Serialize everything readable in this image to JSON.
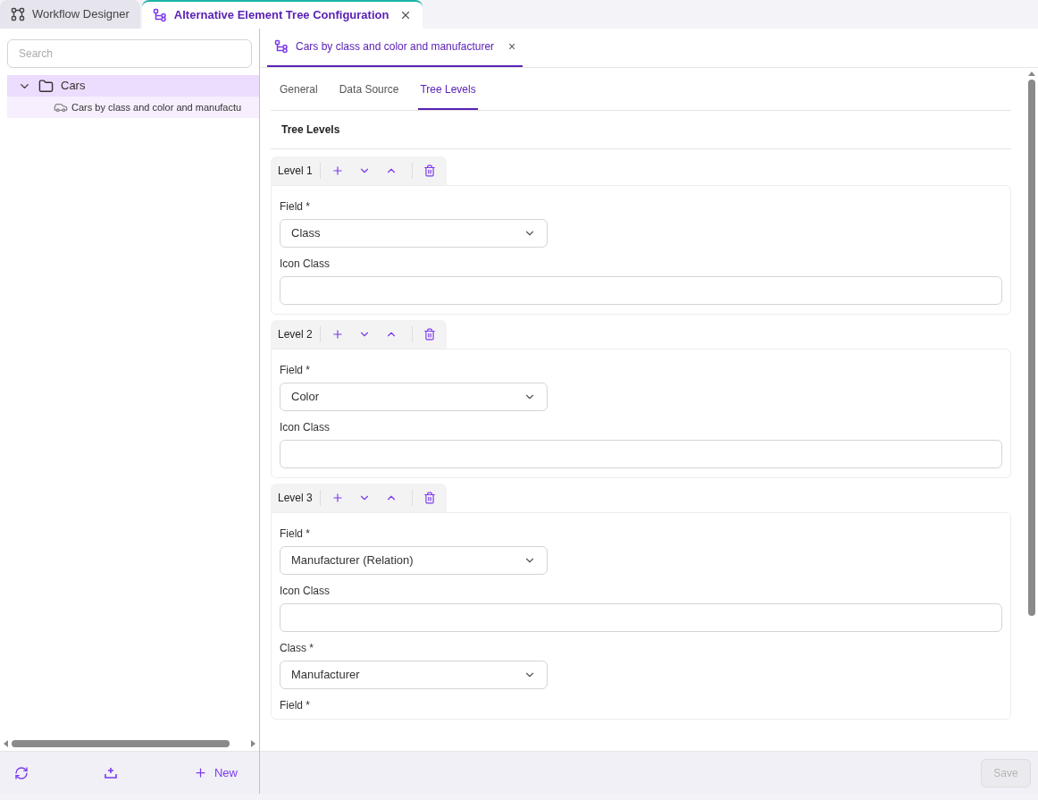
{
  "window_tabs": [
    {
      "label": "Workflow Designer",
      "selected": false,
      "closable": false
    },
    {
      "label": "Alternative Element Tree Configuration",
      "selected": true,
      "closable": true
    }
  ],
  "sidebar": {
    "search": {
      "placeholder": "Search"
    },
    "tree": [
      {
        "label": "Cars",
        "expanded": true,
        "selected": true,
        "children": [
          {
            "label": "Cars by class and color and manufactu",
            "selected": false
          }
        ]
      }
    ],
    "actions": [
      {
        "kind": "refresh"
      },
      {
        "kind": "import"
      },
      {
        "kind": "new",
        "label": "New"
      }
    ]
  },
  "doc_tab": {
    "label": "Cars by class and color and manufacturer",
    "close": "×"
  },
  "tabs": [
    {
      "label": "General",
      "selected": false
    },
    {
      "label": "Data Source",
      "selected": false
    },
    {
      "label": "Tree Levels",
      "selected": true
    }
  ],
  "section_title": "Tree Levels",
  "levels": [
    {
      "title": "Level 1",
      "fields": [
        {
          "kind": "select",
          "label": "Field *",
          "value": "Class"
        },
        {
          "kind": "text",
          "label": "Icon Class"
        }
      ]
    },
    {
      "title": "Level 2",
      "fields": [
        {
          "kind": "select",
          "label": "Field *",
          "value": "Color"
        },
        {
          "kind": "text",
          "label": "Icon Class"
        }
      ]
    },
    {
      "title": "Level 3",
      "fields": [
        {
          "kind": "select",
          "label": "Field *",
          "value": "Manufacturer (Relation)"
        },
        {
          "kind": "text",
          "label": "Icon Class"
        },
        {
          "kind": "select",
          "label": "Class *",
          "value": "Manufacturer"
        },
        {
          "kind": "label",
          "label": "Field *"
        }
      ]
    }
  ],
  "save": {
    "label": "Save",
    "disabled": true
  }
}
